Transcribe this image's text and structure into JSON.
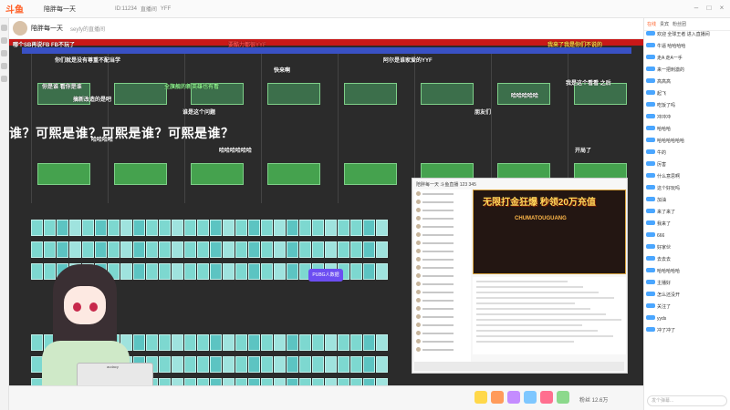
{
  "app": {
    "logo": "斗鱼",
    "room_title": "陪胖每一天"
  },
  "nav": [
    "ID:11234",
    "直播间",
    "YFF"
  ],
  "stream_header": {
    "name": "陪胖每一天",
    "stats": "seyfy的直播间"
  },
  "danmaku": [
    {
      "text": "哪个SB再说FB FB不玩了",
      "color": "#ffffff"
    },
    {
      "text": "要酷力都很YYF",
      "color": "#ff4d4d"
    },
    {
      "text": "你们就是没有尊重不配当学",
      "color": "#ffffff"
    },
    {
      "text": "阿尔是谁家爱的YYF",
      "color": "#ffffff"
    },
    {
      "text": "我来了我是你们不说的",
      "color": "#ffd84a"
    },
    {
      "text": "你是谁 看你是谁",
      "color": "#ffffff"
    },
    {
      "text": "全旗舰的新英雄也有看",
      "color": "#8cf08c"
    },
    {
      "text": "快来啊",
      "color": "#ffffff"
    },
    {
      "text": "哈哈哈哈哈",
      "color": "#ffffff"
    },
    {
      "text": "搞新改造的是吧",
      "color": "#ffffff"
    },
    {
      "text": "谁是这个问题",
      "color": "#ffffff"
    },
    {
      "text": "朋友们",
      "color": "#ffffff"
    },
    {
      "text": "我是这个看看 之后",
      "color": "#ffffff"
    },
    {
      "text": "哈哈哈哈",
      "color": "#ffffff"
    },
    {
      "text": "哈哈哈哈哈哈",
      "color": "#ffffff"
    },
    {
      "text": "开局了",
      "color": "#ffffff"
    }
  ],
  "big_text": "谁？可熙是谁？可熙是谁？可熙是谁？",
  "purple_button": "PUBG人数据",
  "keyboard_label": "audacy",
  "pip": {
    "title": "陪胖每一天 斗鱼直播 123 345",
    "ad_title": "无限打金狂爆 秒领20万充值",
    "ad_sub": "CHUMATOUGUANG"
  },
  "chat": {
    "tabs": [
      "在线",
      "贵宾",
      "粉丝团"
    ],
    "messages": [
      "欢迎 全球王者 进入直播间",
      "牛逼 哈哈哈哈",
      "走A 走A一手",
      "来一把刺激的",
      "高高高",
      "起飞",
      "吃饭了吗",
      "冲冲冲",
      "哈哈哈",
      "哈哈哈哈哈哈",
      "牛的",
      "厉害",
      "什么意思啊",
      "这个好玩吗",
      "加油",
      "来了来了",
      "我来了",
      "666",
      "好家伙",
      "去去去",
      "哈哈哈哈哈",
      "主播好",
      "怎么还没开",
      "关注了",
      "yyds",
      "冲了冲了"
    ],
    "input_placeholder": "发个弹幕..."
  },
  "bottombar": {
    "fans": "粉丝 12.6万"
  }
}
